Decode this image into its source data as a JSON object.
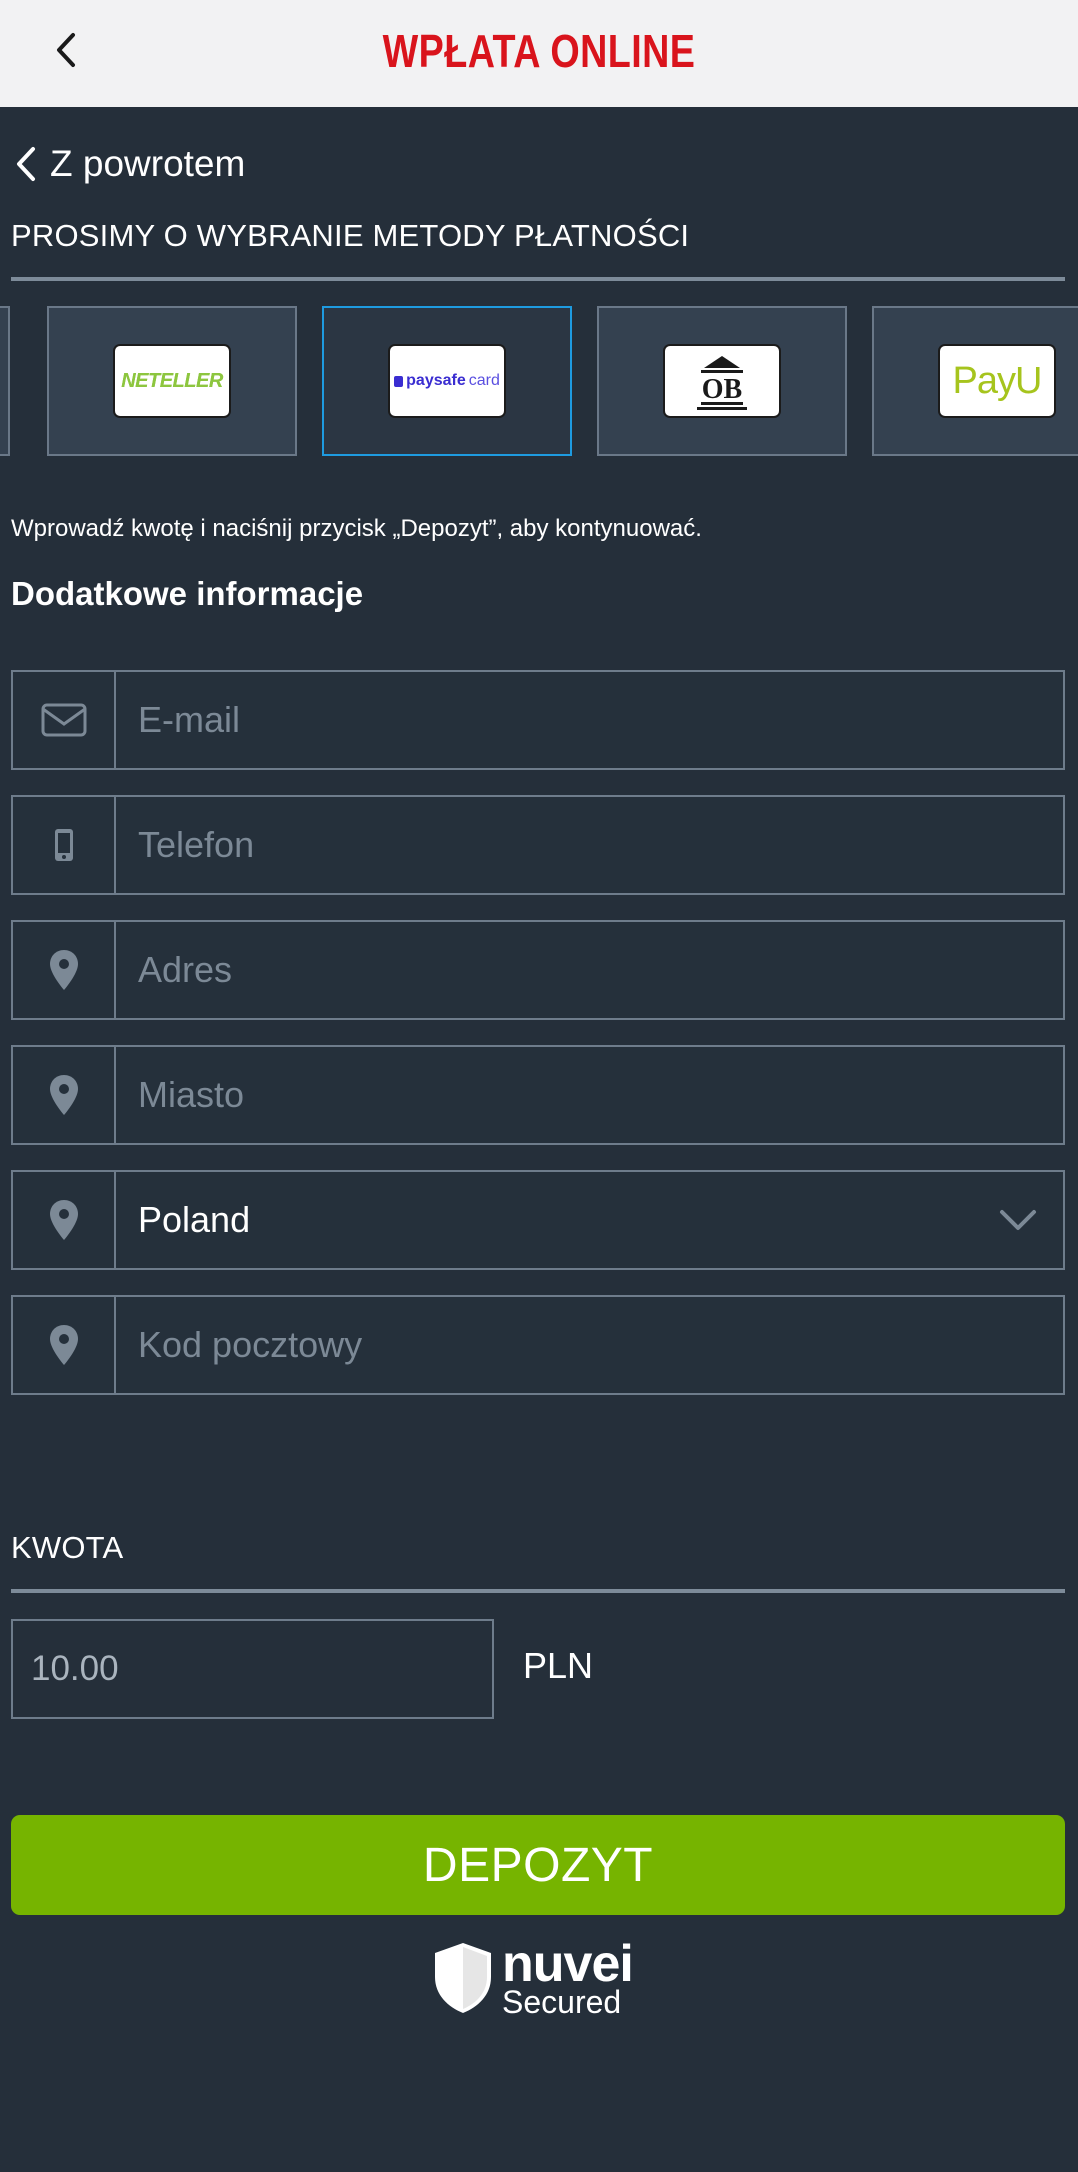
{
  "header": {
    "title": "WPŁATA ONLINE",
    "back_icon": "chevron-left-icon"
  },
  "nav": {
    "go_back_label": "Z powrotem"
  },
  "payment": {
    "section_title": "PROSIMY O WYBRANIE METODY PŁATNOŚCI",
    "methods": [
      {
        "name": "NETELLER",
        "selected": false
      },
      {
        "name": "paysafecard",
        "name_part1": "paysafe",
        "name_part2": "card",
        "selected": true
      },
      {
        "name": "OB",
        "selected": false
      },
      {
        "name": "PayU",
        "selected": false
      }
    ]
  },
  "form": {
    "info_text": "Wprowadź kwotę i naciśnij przycisk „Depozyt”, aby kontynuować.",
    "subheading": "Dodatkowe informacje",
    "fields": {
      "email": {
        "placeholder": "E-mail",
        "icon": "envelope-icon"
      },
      "phone": {
        "placeholder": "Telefon",
        "icon": "mobile-phone-icon"
      },
      "address": {
        "placeholder": "Adres",
        "icon": "location-pin-icon"
      },
      "city": {
        "placeholder": "Miasto",
        "icon": "location-pin-icon"
      },
      "country": {
        "value": "Poland",
        "icon": "location-pin-icon"
      },
      "postal": {
        "placeholder": "Kod pocztowy",
        "icon": "location-pin-icon"
      }
    }
  },
  "amount": {
    "section_title": "KWOTA",
    "value": "10.00",
    "currency": "PLN"
  },
  "deposit_button": {
    "label": "DEPOZYT",
    "color": "#76b400"
  },
  "footer": {
    "brand": "nuvei",
    "secured": "Secured"
  },
  "colors": {
    "background": "#252f3a",
    "accent_red": "#d9141c",
    "selected_border": "#1e9be0"
  }
}
